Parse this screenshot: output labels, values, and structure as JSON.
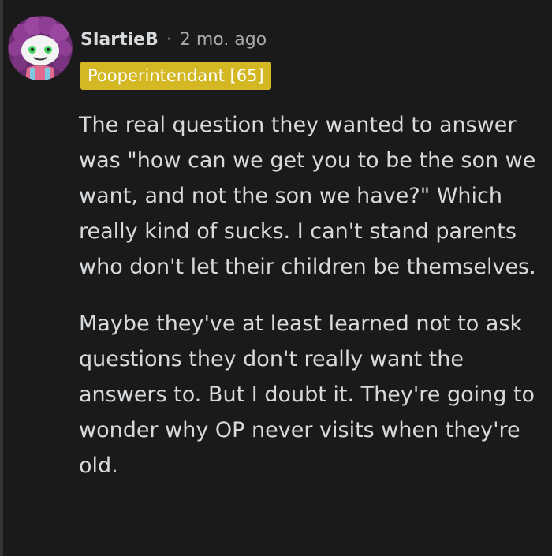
{
  "comment": {
    "username": "SlartieB",
    "separator": "·",
    "timestamp": "2 mo. ago",
    "flair": "Pooperintendant [65]",
    "flair_color": "#d4b823",
    "avatar_icon": "snoo-avatar-icon",
    "paragraphs": [
      "The real question they wanted to answer was \"how can we get you to be the son we want, and not the son we have?\" Which really kind of sucks. I can't stand parents who don't let their children be themselves.",
      "Maybe they've at least learned not to ask questions they don't really want the answers to. But I doubt it. They're going to wonder why OP never visits when they're old."
    ]
  },
  "theme": {
    "background": "#1a1a1b",
    "text": "#d7dadc",
    "muted": "#a8aaab",
    "thread_line": "#343536"
  }
}
